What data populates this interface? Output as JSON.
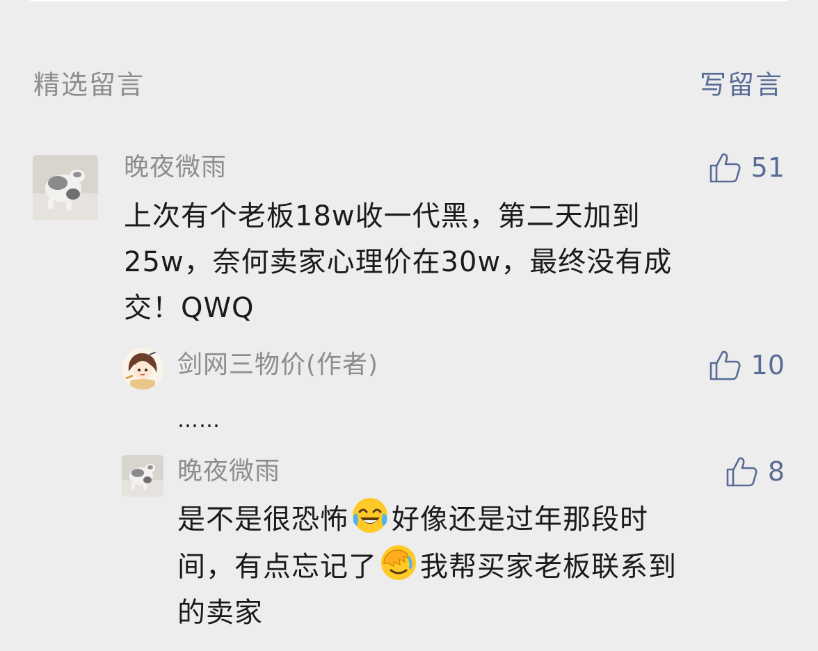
{
  "section": {
    "title": "精选留言",
    "write_label": "写留言"
  },
  "comments": [
    {
      "nickname": "晚夜微雨",
      "likes": "51",
      "avatar_icon": "cat-avatar",
      "content": "上次有个老板18w收一代黑，第二天加到25w，奈何卖家心理价在30w，最终没有成交！QWQ",
      "lines": [
        "上次有个老板18w收一代黑，第二天加到",
        "25w，奈何卖家心理价在30w，最终没有成",
        "交！QWQ"
      ]
    }
  ],
  "replies": [
    {
      "nickname": "剑网三物价(作者)",
      "likes": "10",
      "avatar_icon": "anime-character-avatar",
      "content": "……"
    },
    {
      "nickname": "晚夜微雨",
      "likes": "8",
      "avatar_icon": "cat-avatar",
      "line1_a": "是不是很恐怖",
      "emoji1": "tears-of-joy-emoji",
      "line1_b": "好像还是过年那段时",
      "line2_a": "间，有点忘记了",
      "emoji2": "facepalm-emoji",
      "line2_b": "我帮买家老板联系到",
      "line3": "的卖家"
    }
  ],
  "colors": {
    "background": "#ededed",
    "link": "#576b95",
    "meta": "#8d8d8d",
    "text": "#1a1a1a"
  }
}
